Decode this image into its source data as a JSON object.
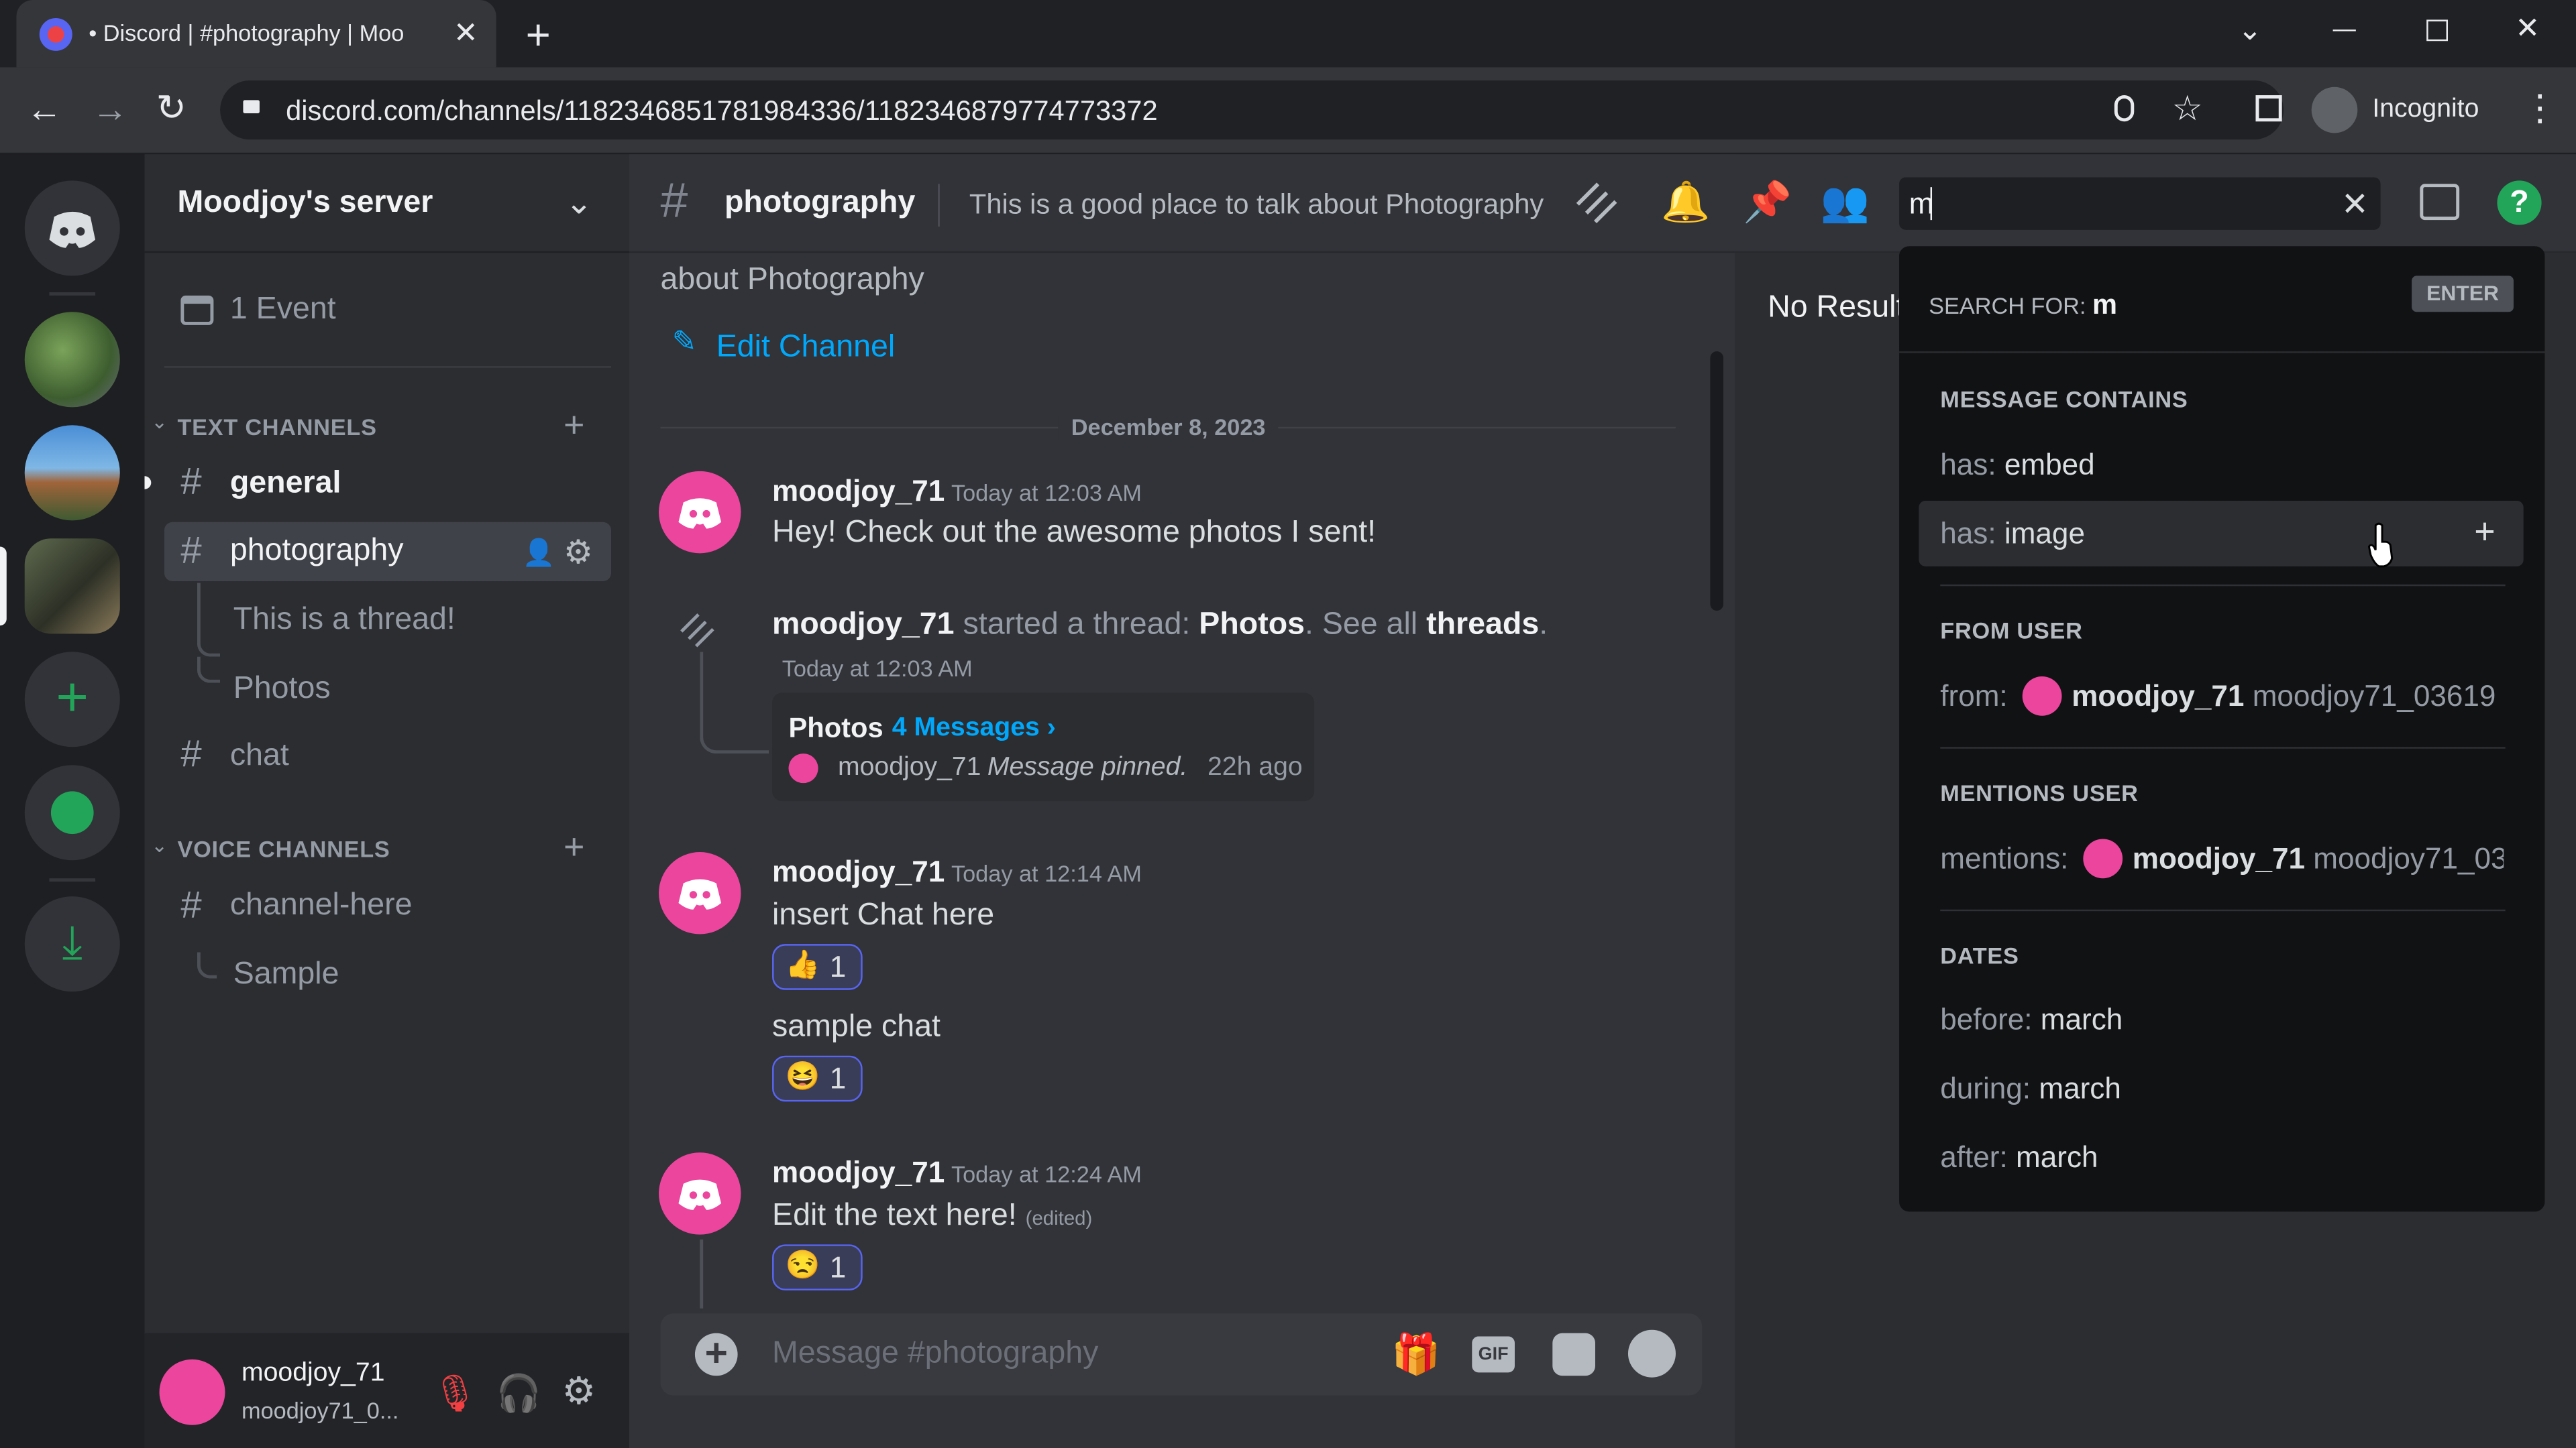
{
  "browser": {
    "tab_title": "• Discord | #photography | Moo",
    "url": "discord.com/channels/1182346851781984336/1182346879774773372",
    "profile_label": "Incognito"
  },
  "server": {
    "name": "Moodjoy's server",
    "events_label": "1 Event",
    "text_category": "TEXT CHANNELS",
    "voice_category": "VOICE CHANNELS",
    "channels": {
      "general": "general",
      "photography": "photography",
      "thread1": "This is a thread!",
      "thread2": "Photos",
      "chat": "chat",
      "voice1": "channel-here",
      "voice_sub": "Sample"
    }
  },
  "user": {
    "name": "moodjoy_71",
    "tag": "moodjoy71_0..."
  },
  "channel_header": {
    "name": "photography",
    "topic": "This is a good place to talk about Photography",
    "search_value": "m"
  },
  "chat": {
    "intro_tail": "about Photography",
    "edit_channel": "Edit Channel",
    "date_divider": "December 8, 2023",
    "messages": [
      {
        "author": "moodjoy_71",
        "time": "Today at 12:03 AM",
        "text": "Hey! Check out the awesome photos I sent!"
      },
      {
        "author": "moodjoy_71",
        "thread_text_1": "started a thread:",
        "thread_name": "Photos",
        "see_all": "See all",
        "threads_link": "threads",
        "time": "Today at 12:03 AM",
        "thread_card": {
          "title": "Photos",
          "count": "4 Messages ›",
          "last_author": "moodjoy_71",
          "last_msg": "Message pinned.",
          "ago": "22h ago"
        }
      },
      {
        "author": "moodjoy_71",
        "time": "Today at 12:14 AM",
        "text": "insert Chat here",
        "reaction_count": "1",
        "text2": "sample chat",
        "reaction2_count": "1"
      },
      {
        "author": "moodjoy_71",
        "time": "Today at 12:24 AM",
        "text": "Edit the text here!",
        "edited": "(edited)",
        "reaction_count": "1"
      }
    ],
    "input_placeholder": "Message #photography"
  },
  "search_panel": {
    "no_results": "No Result",
    "search_for_label": "SEARCH FOR:",
    "search_for_value": "m",
    "enter_label": "ENTER",
    "sections": {
      "message_contains": "MESSAGE CONTAINS",
      "from_user": "FROM USER",
      "mentions_user": "MENTIONS USER",
      "dates": "DATES"
    },
    "has_embed_key": "has:",
    "has_embed_val": "embed",
    "has_image_key": "has:",
    "has_image_val": "image",
    "from_key": "from:",
    "from_name": "moodjoy_71",
    "from_tag": "moodjoy71_03619",
    "mentions_key": "mentions:",
    "mentions_name": "moodjoy_71",
    "mentions_tag": "moodjoy71_03",
    "before_key": "before:",
    "before_val": "march",
    "during_key": "during:",
    "during_val": "march",
    "after_key": "after:",
    "after_val": "march"
  },
  "colors": {
    "blurple": "#5865f2",
    "green": "#23a559",
    "pink_avatar": "#eb459e",
    "link": "#00a8fc"
  }
}
